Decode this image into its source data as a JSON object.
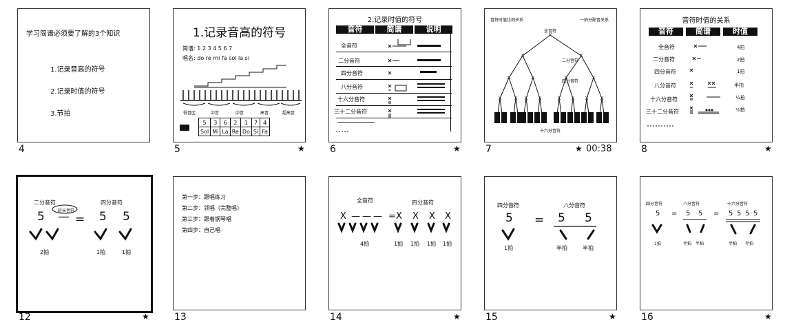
{
  "slides": [
    {
      "num": "4",
      "title": "学习简谱必须要了解的3个知识",
      "items": [
        "1.记录音高的符号",
        "2.记录时值的符号",
        "3.节拍"
      ]
    },
    {
      "num": "5",
      "title": "1.记录音高的符号",
      "line1": "简谱:  1  2  3  4  5  6  7",
      "line2": "唱名:  do  re  mi  fa  sol  la  si",
      "scale_labels": [
        "低音区",
        "中音",
        "中音",
        "高音",
        "超高音"
      ],
      "row1": [
        "5",
        "3",
        "6",
        "2",
        "1",
        "7",
        "4"
      ],
      "row2": [
        "Sol",
        "Mi",
        "La",
        "Re",
        "Do",
        "Si",
        "Fa"
      ]
    },
    {
      "num": "6",
      "title": "2.记录时值的符号",
      "headers": [
        "音符",
        "简谱",
        "说明"
      ],
      "rows": [
        "全音符",
        "二分音符",
        "四分音符",
        "八分音符",
        "十六分音符",
        "三十二分音符"
      ]
    },
    {
      "num": "7",
      "title": "音符时值比例关系",
      "title2": "一拍分配音关系",
      "root": "全音符",
      "l2": "二分音符",
      "l3": "四分音符",
      "bottom": "十六分音符",
      "time": "00:38"
    },
    {
      "num": "8",
      "title": "音符时值的关系",
      "headers": [
        "音符",
        "简谱",
        "时值"
      ],
      "rows": [
        "全音符",
        "二分音符",
        "四分音符",
        "八分音符",
        "十六分音符",
        "三十二分音符"
      ]
    },
    {
      "num": "12",
      "label_a": "二分音符",
      "label_b": "四分音符",
      "note5": "5",
      "dash": "—",
      "eq": "=",
      "bubble": "延长音符",
      "beat_a": "2拍",
      "beat_b": "1拍",
      "beat_c": "1拍"
    },
    {
      "num": "13",
      "steps": [
        "第一步：跟唱练习",
        "第二步：领唱（完整唱）",
        "第三步：跟着钢琴唱",
        "第四步：自己唱"
      ]
    },
    {
      "num": "14",
      "label_a": "全音符",
      "label_b": "四分音符",
      "x": "X",
      "dash": "—",
      "eq": "=",
      "beat_a": "4拍",
      "beats": [
        "1拍",
        "1拍",
        "1拍",
        "1拍"
      ]
    },
    {
      "num": "15",
      "label_a": "四分音符",
      "label_b": "八分音符",
      "note5": "5",
      "eq": "=",
      "beat_a": "1拍",
      "beat_b": "半拍",
      "beat_c": "半拍"
    },
    {
      "num": "16",
      "label_a": "四分音符",
      "label_b": "八分音符",
      "label_c": "十六分音符",
      "note5": "5",
      "eq": "=",
      "beat_a": "1拍",
      "beat_b": "半拍",
      "beat_c": "半拍",
      "beat_d": "半拍",
      "beat_e": "半拍"
    }
  ],
  "star_icon": "★"
}
